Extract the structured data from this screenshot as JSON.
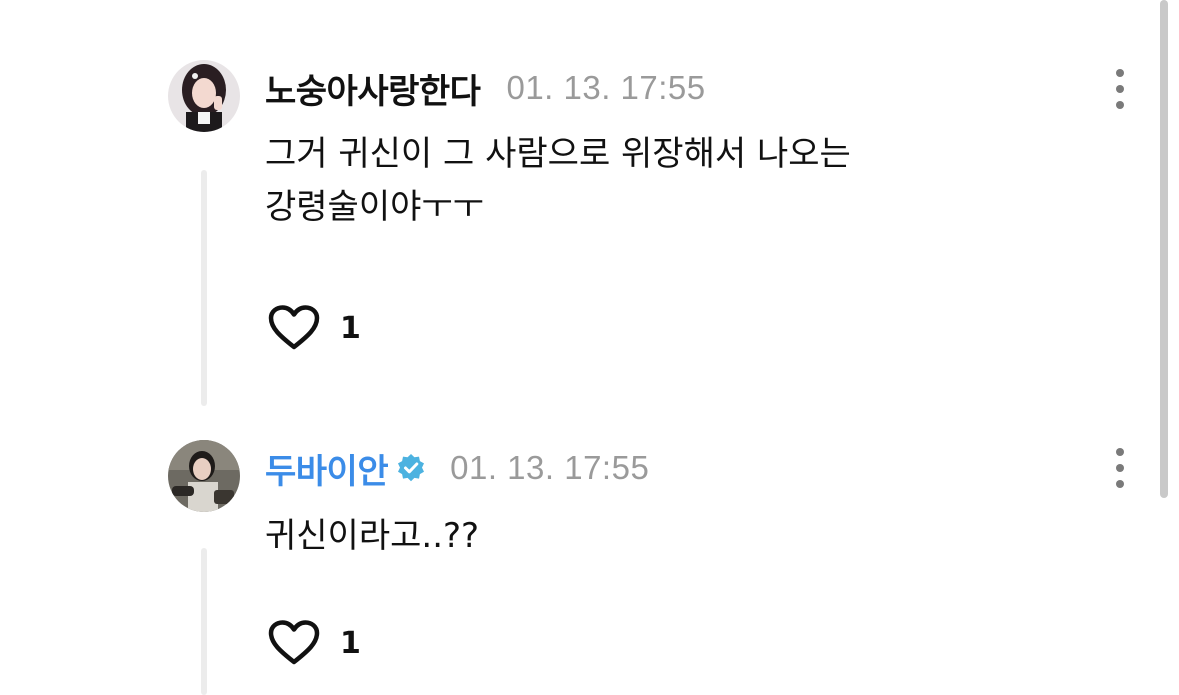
{
  "comments": [
    {
      "author": "노숭아사랑한다",
      "verified": false,
      "timestamp": "01. 13. 17:55",
      "text_lines": [
        "그거 귀신이 그 사람으로 위장해서 나오는",
        "강령술이야ㅜㅜ"
      ],
      "likes": "1"
    },
    {
      "author": "두바이안",
      "verified": true,
      "timestamp": "01. 13. 17:55",
      "text_lines": [
        "귀신이라고..??"
      ],
      "likes": "1"
    }
  ],
  "colors": {
    "verified_name": "#3b8ce8",
    "verified_badge": "#4cb2e0",
    "timestamp": "#9a9a9a",
    "thread_line": "#ececec"
  },
  "icons": {
    "more": "more-vertical-icon",
    "like": "heart-icon",
    "verified": "verified-badge-icon"
  }
}
